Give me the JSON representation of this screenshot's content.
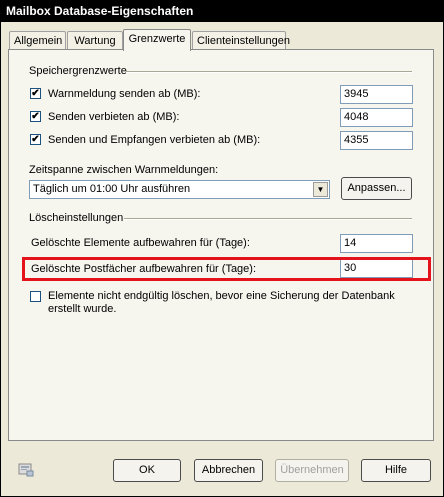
{
  "window": {
    "title": "Mailbox Database-Eigenschaften"
  },
  "tabs": [
    {
      "label": "Allgemein"
    },
    {
      "label": "Wartung"
    },
    {
      "label": "Grenzwerte"
    },
    {
      "label": "Clienteinstellungen"
    }
  ],
  "storage": {
    "group_title": "Speichergrenzwerte",
    "items": [
      {
        "label": "Warnmeldung senden ab (MB):",
        "checked": true,
        "value": "3945"
      },
      {
        "label": "Senden verbieten ab (MB):",
        "checked": true,
        "value": "4048"
      },
      {
        "label": "Senden und Empfangen verbieten ab (MB):",
        "checked": true,
        "value": "4355"
      }
    ],
    "interval_label": "Zeitspanne zwischen Warnmeldungen:",
    "interval_value": "Täglich um 01:00 Uhr ausführen",
    "customize_label": "Anpassen..."
  },
  "deletion": {
    "group_title": "Löscheinstellungen",
    "items_label": "Gelöschte Elemente aufbewahren für (Tage):",
    "items_value": "14",
    "mailboxes_label": "Gelöschte Postfächer aufbewahren für (Tage):",
    "mailboxes_value": "30",
    "no_delete_label": "Elemente nicht endgültig löschen, bevor eine Sicherung der Datenbank erstellt wurde.",
    "no_delete_checked": false
  },
  "buttons": {
    "ok": "OK",
    "cancel": "Abbrechen",
    "apply": "Übernehmen",
    "help": "Hilfe"
  },
  "colors": {
    "highlight": "#e3121b",
    "titlebar": "#000000"
  }
}
